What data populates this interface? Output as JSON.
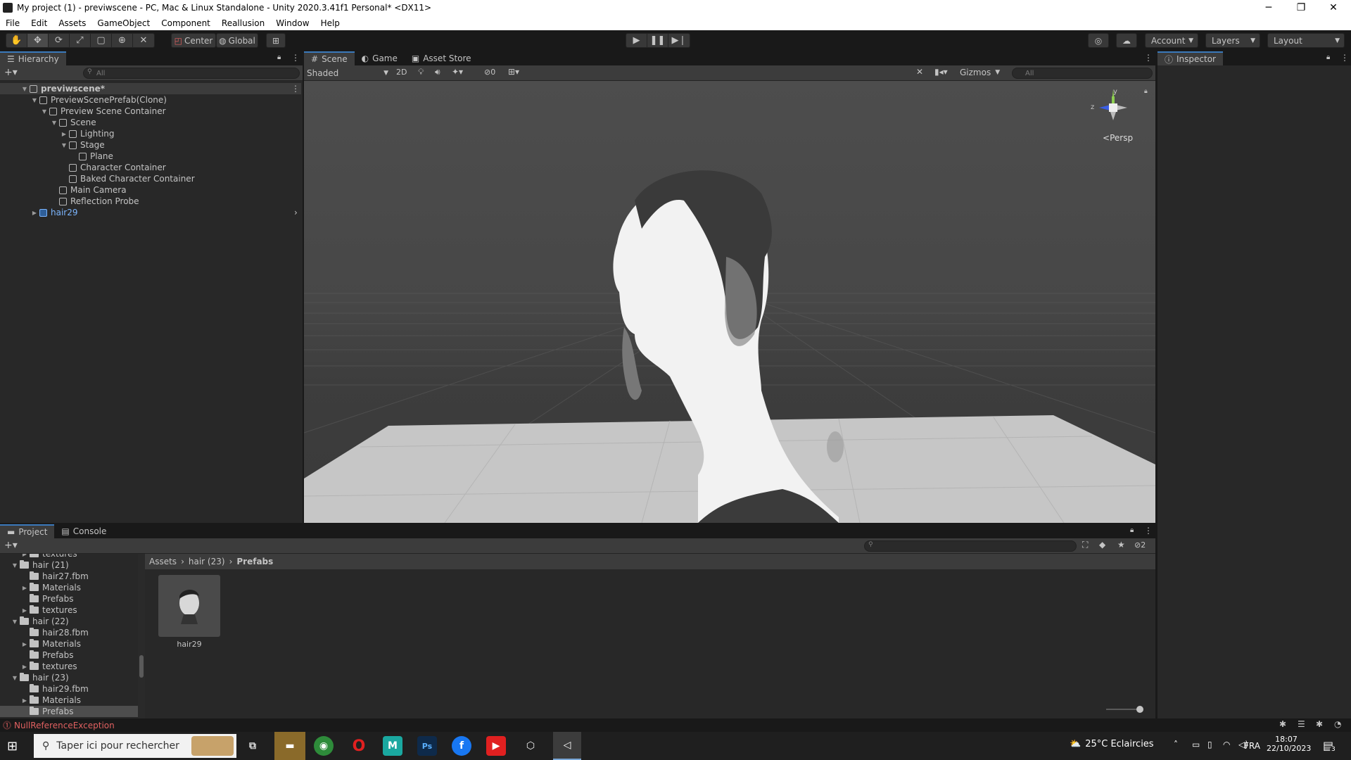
{
  "window": {
    "title": "My project (1) - previwscene - PC, Mac & Linux Standalone - Unity 2020.3.41f1 Personal* <DX11>",
    "controls": {
      "minimize": "─",
      "maximize": "❐",
      "close": "✕"
    }
  },
  "menu": [
    "File",
    "Edit",
    "Assets",
    "GameObject",
    "Component",
    "Reallusion",
    "Window",
    "Help"
  ],
  "toolbar": {
    "pivot_mode": "Center",
    "pivot_rotation": "Global",
    "account": "Account",
    "layers": "Layers",
    "layout": "Layout"
  },
  "hierarchy": {
    "tab": "Hierarchy",
    "search_placeholder": "All",
    "items": [
      {
        "label": "previwscene*",
        "depth": 0,
        "expanded": true,
        "icon": "scene-icon",
        "bold": true
      },
      {
        "label": "PreviewScenePrefab(Clone)",
        "depth": 1,
        "expanded": true,
        "icon": "cube-icon"
      },
      {
        "label": "Preview Scene Container",
        "depth": 2,
        "expanded": true,
        "icon": "cube-icon"
      },
      {
        "label": "Scene",
        "depth": 3,
        "expanded": true,
        "icon": "cube-icon"
      },
      {
        "label": "Lighting",
        "depth": 4,
        "expanded": false,
        "icon": "cube-icon"
      },
      {
        "label": "Stage",
        "depth": 4,
        "expanded": true,
        "icon": "cube-icon"
      },
      {
        "label": "Plane",
        "depth": 5,
        "expanded": null,
        "icon": "cube-icon"
      },
      {
        "label": "Character Container",
        "depth": 4,
        "expanded": null,
        "icon": "cube-icon"
      },
      {
        "label": "Baked Character Container",
        "depth": 4,
        "expanded": null,
        "icon": "cube-icon"
      },
      {
        "label": "Main Camera",
        "depth": 3,
        "expanded": null,
        "icon": "cube-icon"
      },
      {
        "label": "Reflection Probe",
        "depth": 3,
        "expanded": null,
        "icon": "cube-icon"
      },
      {
        "label": "hair29",
        "depth": 1,
        "expanded": false,
        "icon": "prefab-icon",
        "prefab": true
      }
    ]
  },
  "scene": {
    "tabs": [
      "Scene",
      "Game",
      "Asset Store"
    ],
    "shading": "Shaded",
    "mode_2d": "2D",
    "hidden_count": "0",
    "gizmos": "Gizmos",
    "search_placeholder": "All",
    "projection": "Persp",
    "axis_y": "y",
    "axis_z": "z"
  },
  "inspector": {
    "tab": "Inspector"
  },
  "project": {
    "tabs": [
      "Project",
      "Console"
    ],
    "tree": [
      {
        "label": "textures",
        "depth": 2,
        "folder": true,
        "expanded": false
      },
      {
        "label": "hair (21)",
        "depth": 1,
        "folder": true,
        "expanded": true
      },
      {
        "label": "hair27.fbm",
        "depth": 2,
        "folder": true,
        "expanded": null
      },
      {
        "label": "Materials",
        "depth": 2,
        "folder": true,
        "expanded": false
      },
      {
        "label": "Prefabs",
        "depth": 2,
        "folder": true,
        "expanded": null
      },
      {
        "label": "textures",
        "depth": 2,
        "folder": true,
        "expanded": false
      },
      {
        "label": "hair (22)",
        "depth": 1,
        "folder": true,
        "expanded": true
      },
      {
        "label": "hair28.fbm",
        "depth": 2,
        "folder": true,
        "expanded": null
      },
      {
        "label": "Materials",
        "depth": 2,
        "folder": true,
        "expanded": false
      },
      {
        "label": "Prefabs",
        "depth": 2,
        "folder": true,
        "expanded": null
      },
      {
        "label": "textures",
        "depth": 2,
        "folder": true,
        "expanded": false
      },
      {
        "label": "hair (23)",
        "depth": 1,
        "folder": true,
        "expanded": true
      },
      {
        "label": "hair29.fbm",
        "depth": 2,
        "folder": true,
        "expanded": null
      },
      {
        "label": "Materials",
        "depth": 2,
        "folder": true,
        "expanded": false
      },
      {
        "label": "Prefabs",
        "depth": 2,
        "folder": true,
        "expanded": null,
        "selected": true
      }
    ],
    "breadcrumb": [
      "Assets",
      "hair (23)",
      "Prefabs"
    ],
    "assets": [
      {
        "label": "hair29"
      }
    ],
    "hidden_count": "2"
  },
  "status": {
    "error": "NullReferenceException"
  },
  "taskbar": {
    "search_placeholder": "Taper ici pour rechercher",
    "weather": "25°C  Eclaircies",
    "language": "FRA",
    "time": "18:07",
    "date": "22/10/2023",
    "notifications": "3"
  },
  "colors": {
    "accent": "#3a79bb",
    "panel": "#282828",
    "toolbar": "#3c3c3c",
    "error": "#e06060",
    "prefab": "#7cb6ff"
  }
}
